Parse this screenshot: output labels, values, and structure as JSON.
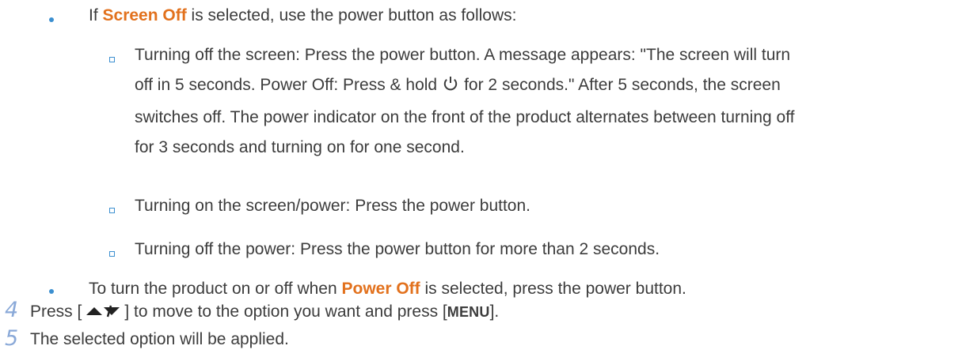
{
  "bullet1": {
    "prefix": "If ",
    "highlight": "Screen Off",
    "suffix": " is selected, use the power button as follows:"
  },
  "sub1": {
    "line1": "Turning off the screen: Press the power button. A message appears: \"The screen will turn",
    "line2_a": "off in 5 seconds. Power Off: Press & hold",
    "power_icon": "power-icon",
    "line2_b": "for 2 seconds.\" After 5 seconds, the screen",
    "line3": "switches off. The power indicator on the front of the product alternates between turning off",
    "line4": "for 3 seconds and turning on for one second."
  },
  "sub2": "Turning on the screen/power: Press the power button.",
  "sub3": "Turning off the power: Press the power button for more than 2 seconds.",
  "bullet2": {
    "prefix": "To turn the product on or off when ",
    "highlight": "Power Off",
    "suffix": " is selected, press the power button."
  },
  "step4": {
    "number": "4",
    "prefix": "Press [",
    "arrows_icon": "up-down-arrows-icon",
    "mid": "] to move to the option you want and press [",
    "key": "MENU",
    "suffix": "]."
  },
  "step5": {
    "number": "5",
    "text": "The selected option will be applied."
  },
  "colors": {
    "highlight": "#e2711d",
    "bullet": "#3b8fd0",
    "step_number": "#8aa9d8",
    "text": "#3c3c3c"
  }
}
